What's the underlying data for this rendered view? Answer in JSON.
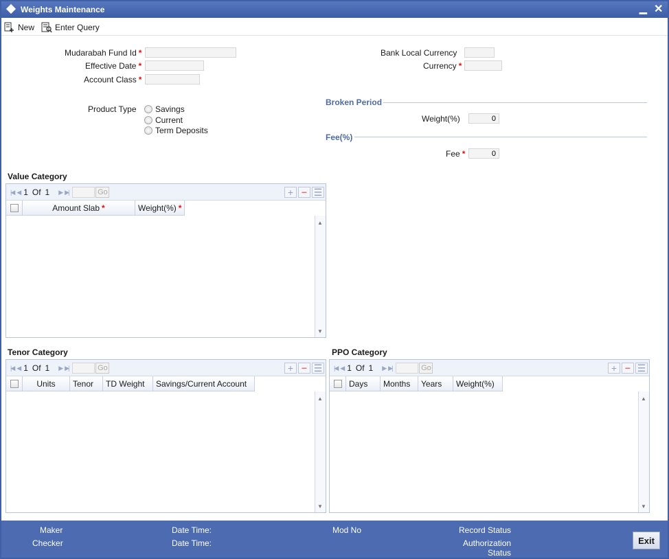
{
  "window": {
    "title": "Weights Maintenance"
  },
  "toolbar": {
    "new_label": "New",
    "enter_query_label": "Enter Query"
  },
  "form": {
    "mudarabah_fund_id": {
      "label": "Mudarabah Fund Id",
      "value": ""
    },
    "effective_date": {
      "label": "Effective Date",
      "value": ""
    },
    "account_class": {
      "label": "Account Class",
      "value": ""
    },
    "bank_local_currency": {
      "label": "Bank Local Currency",
      "value": ""
    },
    "currency": {
      "label": "Currency",
      "value": ""
    },
    "product_type": {
      "label": "Product Type",
      "options": [
        "Savings",
        "Current",
        "Term Deposits"
      ]
    },
    "broken_period": {
      "heading": "Broken Period",
      "weight_label": "Weight(%)",
      "weight_value": "0"
    },
    "fee_section": {
      "heading": "Fee(%)",
      "fee_label": "Fee",
      "fee_value": "0"
    }
  },
  "value_category": {
    "title": "Value Category",
    "pager": {
      "current": "1",
      "of": "Of",
      "total": "1",
      "go": "Go"
    },
    "columns": [
      "Amount Slab",
      "Weight(%)"
    ],
    "rows": []
  },
  "tenor_category": {
    "title": "Tenor Category",
    "pager": {
      "current": "1",
      "of": "Of",
      "total": "1",
      "go": "Go"
    },
    "columns": [
      "Units",
      "Tenor",
      "TD Weight",
      "Savings/Current Account"
    ],
    "rows": []
  },
  "ppo_category": {
    "title": "PPO Category",
    "pager": {
      "current": "1",
      "of": "Of",
      "total": "1",
      "go": "Go"
    },
    "columns": [
      "Days",
      "Months",
      "Years",
      "Weight(%)"
    ],
    "rows": []
  },
  "footer": {
    "maker": "Maker",
    "checker": "Checker",
    "date_time_1": "Date Time:",
    "date_time_2": "Date Time:",
    "mod_no": "Mod No",
    "record_status": "Record Status",
    "authorization_status_line1": "Authorization",
    "authorization_status_line2": "Status",
    "exit_label": "Exit"
  },
  "colors": {
    "title_bar": "#3d5ea6",
    "footer": "#4c6bb0",
    "section_heading": "#4d6aa8",
    "required": "#dd1111"
  }
}
